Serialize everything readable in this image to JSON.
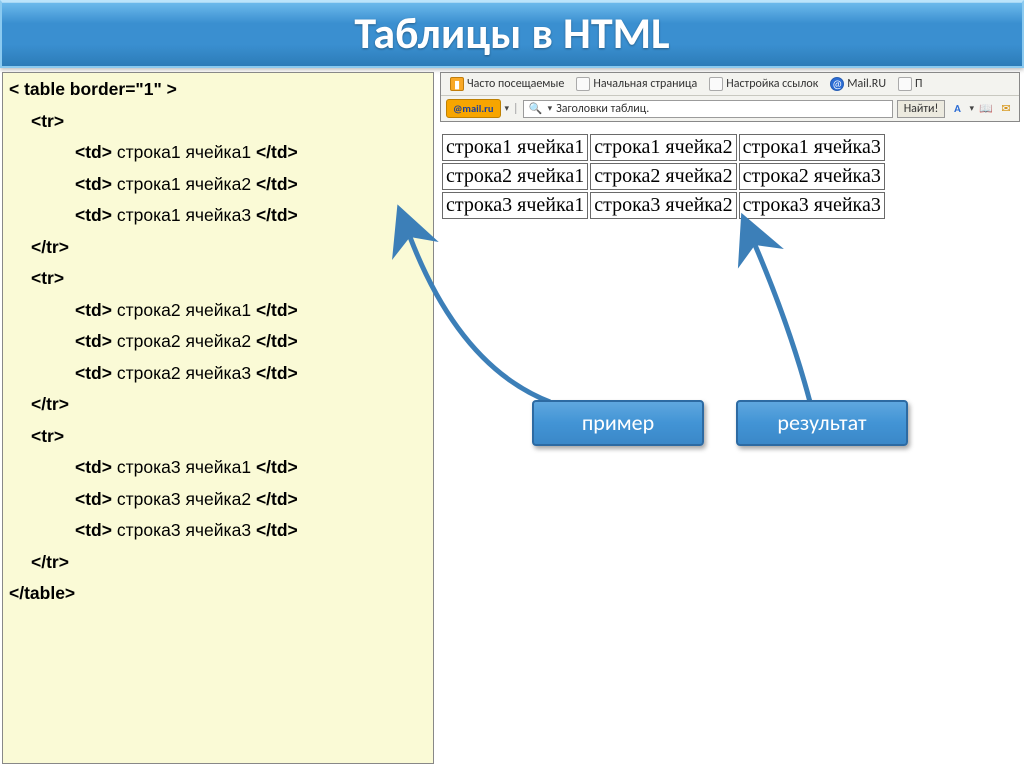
{
  "title": "Таблицы в HTML",
  "code": {
    "l0": "< table border=\"1\" >",
    "l1": "<tr>",
    "l2": "строка1 ячейка1",
    "l3": "строка1 ячейка2",
    "l4": "строка1 ячейка3",
    "l5": "</tr>",
    "l6": "<tr>",
    "l7": "строка2 ячейка1",
    "l8": "строка2 ячейка2",
    "l9": "строка2 ячейка3",
    "l10": "</tr>",
    "l11": "<tr>",
    "l12": "строка3 ячейка1",
    "l13": "строка3 ячейка2",
    "l14": "строка3 ячейка3",
    "l15": "</tr>",
    "l16": "</table>",
    "td_open": "<td>",
    "td_close": "</td>"
  },
  "browser": {
    "bookmarks": {
      "often": "Часто посещаемые",
      "start": "Начальная страница",
      "links": "Настройка ссылок",
      "mail": "Mail.RU",
      "p": "П"
    },
    "logo": "@mail.ru",
    "search_value": "Заголовки таблиц.",
    "find": "Найти!"
  },
  "table": {
    "r1c1": "строка1 ячейка1",
    "r1c2": "строка1 ячейка2",
    "r1c3": "строка1 ячейка3",
    "r2c1": "строка2 ячейка1",
    "r2c2": "строка2 ячейка2",
    "r2c3": "строка2 ячейка3",
    "r3c1": "строка3 ячейка1",
    "r3c2": "строка3 ячейка2",
    "r3c3": "строка3 ячейка3"
  },
  "callouts": {
    "example": "пример",
    "result": "результат"
  }
}
